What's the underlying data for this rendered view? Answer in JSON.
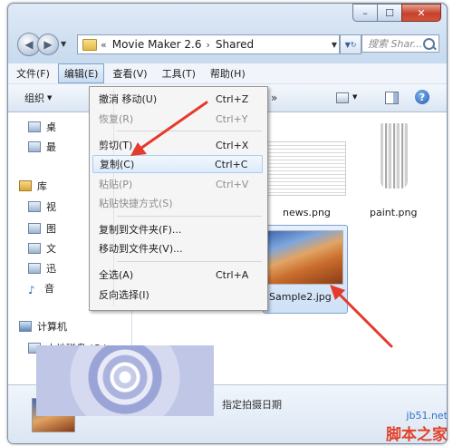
{
  "window": {
    "controls": {
      "minimize_icon": "minimize-icon",
      "maximize_icon": "maximize-icon",
      "close_icon": "close-icon"
    }
  },
  "addressbar": {
    "prefix": "«",
    "path": [
      "Movie Maker 2.6",
      "Shared"
    ],
    "separator": "›",
    "search_placeholder": "搜索 Shar..."
  },
  "menubar": {
    "items": [
      {
        "label": "文件(F)",
        "active": false
      },
      {
        "label": "编辑(E)",
        "active": true
      },
      {
        "label": "查看(V)",
        "active": false
      },
      {
        "label": "工具(T)",
        "active": false
      },
      {
        "label": "帮助(H)",
        "active": false
      }
    ]
  },
  "toolbar": {
    "organize": "组织",
    "more": "»"
  },
  "navpane": {
    "items": [
      {
        "label": "桌",
        "icon": "desktop-icon"
      },
      {
        "label": "最",
        "icon": "recent-places-icon"
      },
      {
        "label": "库",
        "icon": "library-icon"
      },
      {
        "label": "视",
        "icon": "videos-icon"
      },
      {
        "label": "图",
        "icon": "pictures-icon"
      },
      {
        "label": "文",
        "icon": "documents-icon"
      },
      {
        "label": "迅",
        "icon": "download-icon"
      },
      {
        "label": "音",
        "icon": "music-icon"
      },
      {
        "label": "计算机",
        "icon": "computer-icon"
      },
      {
        "label": "本地磁盘 (C:)",
        "icon": "local-disk-icon"
      }
    ]
  },
  "content": {
    "files": [
      {
        "name": "news.png",
        "selected": false
      },
      {
        "name": "paint.png",
        "selected": false
      },
      {
        "name": "Sample2.jpg",
        "selected": true
      }
    ]
  },
  "edit_menu": {
    "items": [
      {
        "label": "撤消 移动(U)",
        "shortcut": "Ctrl+Z",
        "disabled": false,
        "highlighted": false
      },
      {
        "label": "恢复(R)",
        "shortcut": "Ctrl+Y",
        "disabled": true,
        "highlighted": false
      },
      {
        "label": "剪切(T)",
        "shortcut": "Ctrl+X",
        "disabled": false,
        "highlighted": false
      },
      {
        "label": "复制(C)",
        "shortcut": "Ctrl+C",
        "disabled": false,
        "highlighted": true
      },
      {
        "label": "粘贴(P)",
        "shortcut": "Ctrl+V",
        "disabled": true,
        "highlighted": false
      },
      {
        "label": "粘贴快捷方式(S)",
        "shortcut": "",
        "disabled": true,
        "highlighted": false
      },
      {
        "label": "复制到文件夹(F)...",
        "shortcut": "",
        "disabled": false,
        "highlighted": false
      },
      {
        "label": "移动到文件夹(V)...",
        "shortcut": "",
        "disabled": false,
        "highlighted": false
      },
      {
        "label": "全选(A)",
        "shortcut": "Ctrl+A",
        "disabled": false,
        "highlighted": false
      },
      {
        "label": "反向选择(I)",
        "shortcut": "",
        "disabled": false,
        "highlighted": false
      }
    ]
  },
  "statusbar": {
    "text": "指定拍摄日期"
  },
  "annotations": {
    "arrow_color": "#e53a2e"
  },
  "watermark": {
    "site": "jb51.net",
    "brand": "脚本之家"
  }
}
